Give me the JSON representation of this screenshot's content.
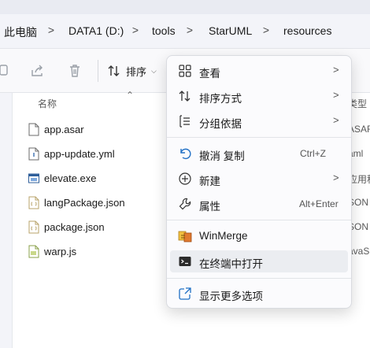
{
  "breadcrumb": {
    "items": [
      "此电脑",
      "DATA1 (D:)",
      "tools",
      "StarUML",
      "resources"
    ],
    "separator": ">"
  },
  "toolbar": {
    "sort_label": "排序",
    "icons": [
      "copy-icon",
      "share-icon",
      "delete-icon",
      "sort-icon"
    ]
  },
  "file_list": {
    "name_header": "名称",
    "type_header": "类型",
    "files": [
      {
        "name": "app.asar",
        "type": "ASAR",
        "icon": "blank-file-icon"
      },
      {
        "name": "app-update.yml",
        "type": "aml",
        "icon": "info-file-icon"
      },
      {
        "name": "elevate.exe",
        "type": "应用程",
        "icon": "exe-file-icon"
      },
      {
        "name": "langPackage.json",
        "type": "SON",
        "icon": "json-file-icon"
      },
      {
        "name": "package.json",
        "type": "SON",
        "icon": "json-file-icon"
      },
      {
        "name": "warp.js",
        "type": "avaS",
        "icon": "js-file-icon"
      }
    ]
  },
  "context_menu": {
    "items": [
      {
        "label": "查看",
        "submenu": true,
        "icon": "view-grid-icon"
      },
      {
        "label": "排序方式",
        "submenu": true,
        "icon": "sort-icon"
      },
      {
        "label": "分组依据",
        "submenu": true,
        "icon": "group-by-icon"
      },
      {
        "label": "撤消 复制",
        "shortcut": "Ctrl+Z",
        "icon": "undo-icon"
      },
      {
        "label": "新建",
        "submenu": true,
        "icon": "new-icon"
      },
      {
        "label": "属性",
        "shortcut": "Alt+Enter",
        "icon": "wrench-icon"
      },
      {
        "label": "WinMerge",
        "icon": "winmerge-icon"
      },
      {
        "label": "在终端中打开",
        "icon": "terminal-icon",
        "hovered": true
      },
      {
        "label": "显示更多选项",
        "icon": "more-options-icon"
      }
    ],
    "arrow": ">"
  },
  "colors": {
    "accent": "#0067c0",
    "menu_background": "#fbfbfd",
    "hover_background": "#ebedf1",
    "address_bar": "#f3f4f9"
  }
}
